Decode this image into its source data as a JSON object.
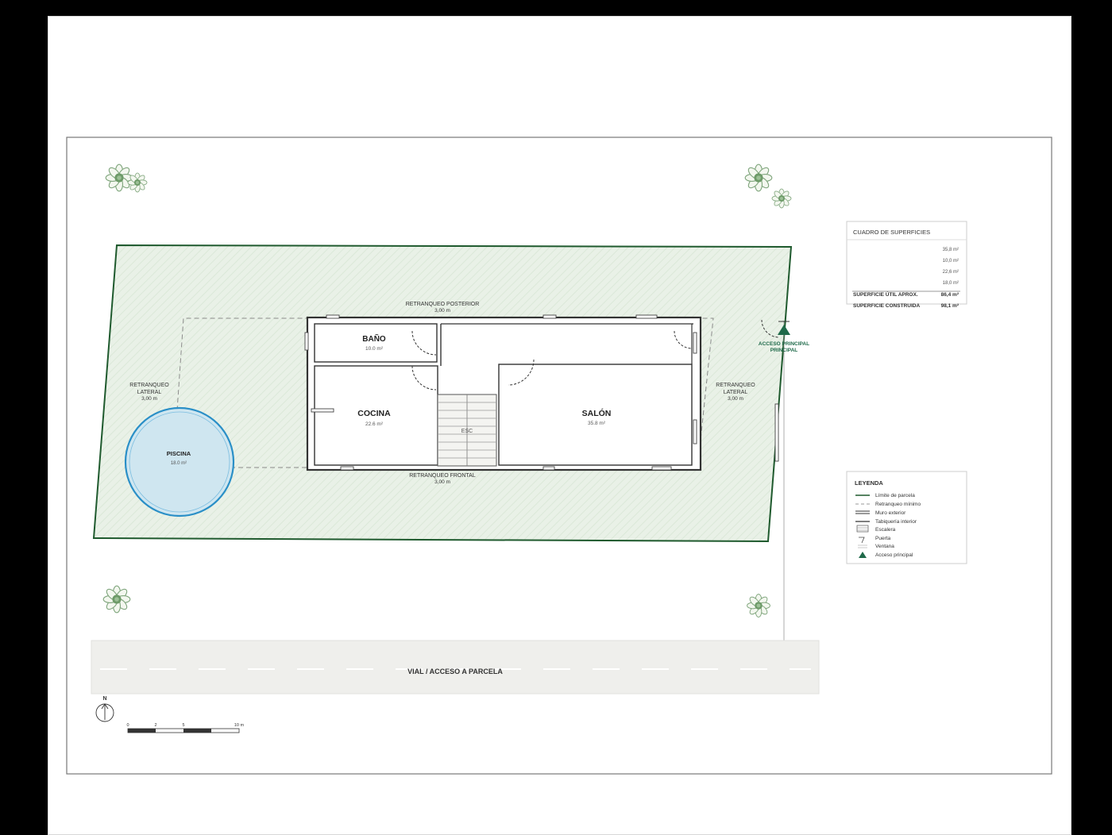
{
  "rooms": {
    "bano": {
      "name": "BAÑO",
      "area": "10.0 m²"
    },
    "cocina": {
      "name": "COCINA",
      "area": "22.6 m²"
    },
    "salon": {
      "name": "SALÓN",
      "area": "35.8 m²"
    },
    "piscina": {
      "name": "PISCINA",
      "area": "18.0 m²"
    },
    "escalera": "ESC"
  },
  "setbacks": {
    "posterior": {
      "title": "RETRANQUEO POSTERIOR",
      "value": "3,00 m"
    },
    "frontal": {
      "title": "RETRANQUEO FRONTAL",
      "value": "3,00 m"
    },
    "lateral_left": {
      "title1": "RETRANQUEO",
      "title2": "LATERAL",
      "value": "3,00 m"
    },
    "lateral_right": {
      "title1": "RETRANQUEO",
      "title2": "LATERAL",
      "value": "3,00 m"
    }
  },
  "access": {
    "line1": "ACCESO PRINCIPAL",
    "line2": "PRINCIPAL"
  },
  "road": {
    "label": "VIAL / ACCESO A PARCELA"
  },
  "north": {
    "label": "N"
  },
  "scale": {
    "ticks": [
      "0",
      "2",
      "5",
      "10 m"
    ]
  },
  "surfaces": {
    "title": "CUADRO DE SUPERFICIES",
    "values": [
      "35,8 m²",
      "10,0 m²",
      "22,6 m²",
      "18,0 m²"
    ],
    "util_label": "SUPERFICIE ÚTIL APROX.",
    "util_value": "86,4 m²",
    "built_label": "SUPERFICIE CONSTRUIDA",
    "built_value": "98,1 m²"
  },
  "legend": {
    "title": "LEYENDA",
    "items": [
      {
        "label": "Límite de parcela",
        "icon": "parcel-line-icon"
      },
      {
        "label": "Retranqueo mínimo",
        "icon": "setback-dash-icon"
      },
      {
        "label": "Muro exterior",
        "icon": "exterior-wall-icon"
      },
      {
        "label": "Tabiquería interior",
        "icon": "interior-wall-icon"
      },
      {
        "label": "Escalera",
        "icon": "stair-icon"
      },
      {
        "label": "Puerta",
        "icon": "door-icon"
      },
      {
        "label": "Ventana",
        "icon": "window-icon"
      },
      {
        "label": "Acceso principal",
        "icon": "access-triangle-icon"
      }
    ]
  },
  "colors": {
    "parcel": "#1f5a2e",
    "parcel_fill": "#e8f1e6",
    "pool": "#2a8fc7",
    "pool_fill": "#cfe6f0",
    "access": "#1f6a4a",
    "road": "#efefec"
  }
}
